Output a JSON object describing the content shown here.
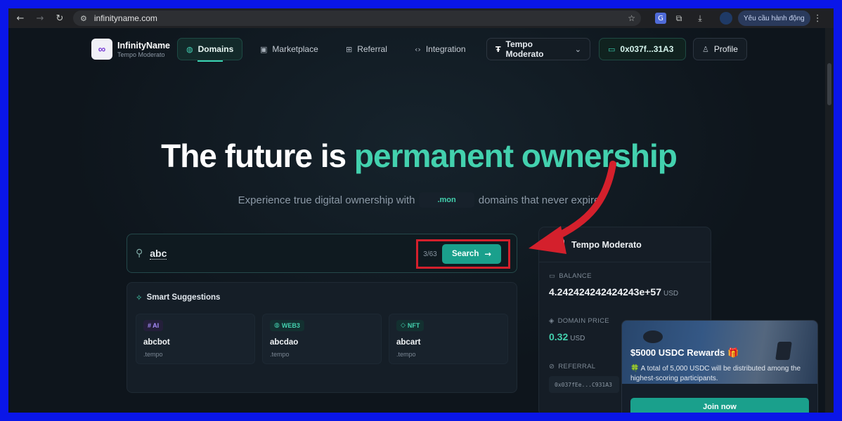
{
  "browser": {
    "url": "infinityname.com",
    "request_label": "Yêu cầu hành động"
  },
  "brand": {
    "name": "InfinityName",
    "network": "Tempo Moderato",
    "logo_symbol": "∞"
  },
  "nav": {
    "domains": "Domains",
    "marketplace": "Marketplace",
    "referral": "Referral",
    "integration": "Integration",
    "network_selector": "Tempo Moderato",
    "wallet": "0x037f...31A3",
    "profile": "Profile"
  },
  "hero": {
    "title_main": "The future is ",
    "title_accent": "permanent ownership",
    "subtitle_before": "Experience true digital ownership with",
    "tld": ".mon",
    "subtitle_after": "domains that never expire"
  },
  "search": {
    "query": "abc",
    "counter": "3/63",
    "button_label": "Search"
  },
  "suggestions": {
    "heading": "Smart Suggestions",
    "items": [
      {
        "tag": "# AI",
        "name": "abcbot",
        "tld": ".tempo",
        "tag_color": "#a78bfa"
      },
      {
        "tag": "WEB3",
        "name": "abcdao",
        "tld": ".tempo",
        "tag_color": "#43d1ae"
      },
      {
        "tag": "NFT",
        "name": "abcart",
        "tld": ".tempo",
        "tag_color": "#43d1ae"
      }
    ]
  },
  "network_card": {
    "name": "Tempo Moderato",
    "balance_label": "BALANCE",
    "balance_value": "4.242424242424243e+57",
    "balance_unit": "USD",
    "price_label": "DOMAIN PRICE",
    "price_value": "0.32",
    "price_unit": "USD",
    "referral_label": "REFERRAL",
    "referral_code": "0x037fEe...C931A3"
  },
  "reward": {
    "title": "$5000 USDC Rewards 🎁",
    "description": "🍀 A total of 5,000 USDC will be distributed among the highest-scoring participants.",
    "button": "Join now"
  },
  "colors": {
    "accent": "#43d1ae",
    "button": "#1aa08c",
    "highlight_box": "#d4202c",
    "frame_border": "#0a16e8"
  }
}
